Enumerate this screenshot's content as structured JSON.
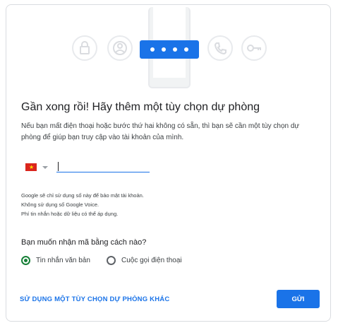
{
  "header": {
    "title": "Gần xong rồi! Hãy thêm một tùy chọn dự phòng",
    "description": "Nếu bạn mất điện thoại hoặc bước thứ hai không có sẵn, thì bạn sẽ cần một tùy chọn dự phòng để giúp bạn truy cập vào tài khoản của mình."
  },
  "illustration": {
    "icons": [
      "lock-icon",
      "person-icon",
      "phone-call-icon",
      "key-icon"
    ],
    "accent": "#1a73e8"
  },
  "phone_entry": {
    "country": "Vietnam",
    "value": "",
    "placeholder": ""
  },
  "notes": [
    "Google sẽ chỉ sử dụng số này để bảo mật tài khoản.",
    "Không sử dụng số Google Voice.",
    "Phí tin nhắn hoặc dữ liệu có thể áp dụng."
  ],
  "method": {
    "question": "Bạn muốn nhận mã bằng cách nào?",
    "options": [
      {
        "label": "Tin nhắn văn bản",
        "selected": true
      },
      {
        "label": "Cuộc gọi điện thoại",
        "selected": false
      }
    ]
  },
  "actions": {
    "other_option": "SỬ DỤNG MỘT TÙY CHỌN DỰ PHÒNG KHÁC",
    "send": "GỬI"
  },
  "colors": {
    "primary": "#1a73e8",
    "radio_selected": "#188038",
    "border": "#dadce0"
  }
}
